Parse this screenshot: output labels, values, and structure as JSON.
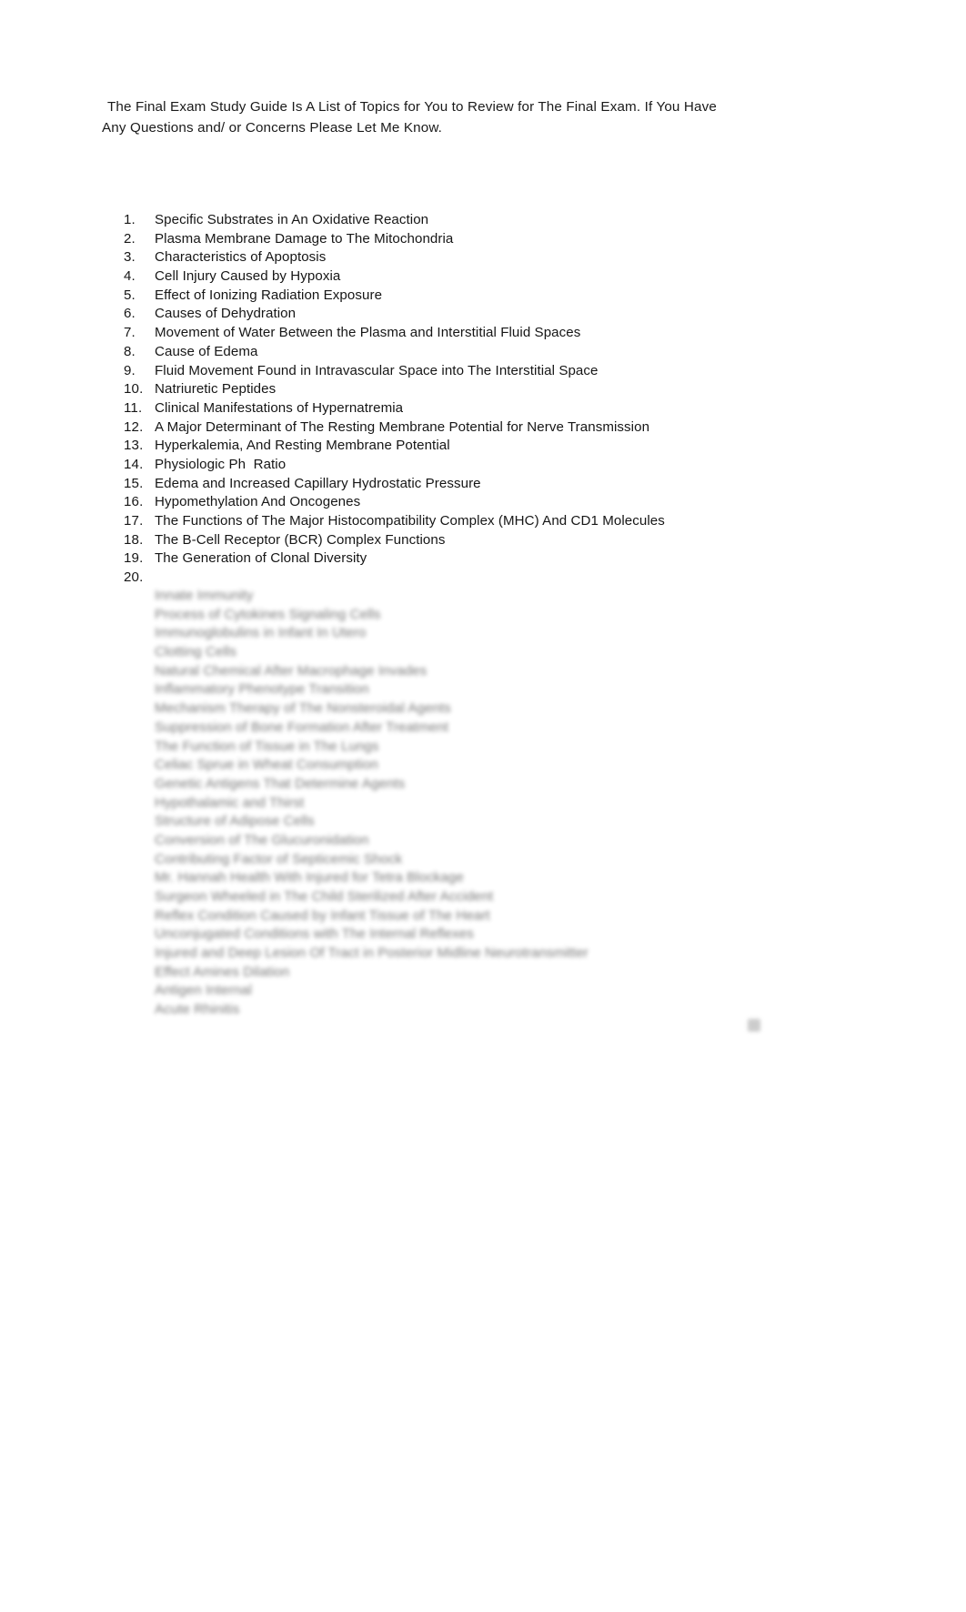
{
  "document": {
    "intro_line_1": "The Final Exam Study Guide Is A List of Topics for You to Review for The Final Exam. If You Have Any",
    "intro_line_2": "Questions and/ or Concerns Please Let Me Know.",
    "intro_paragraph": "The Final Exam Study Guide Is A List of Topics for You to Review for The Final Exam. If You Have Any Questions and/ or Concerns Please Let Me Know.",
    "text_color": "#161616",
    "background_color": "#ffffff"
  },
  "study_guide_list": {
    "items": [
      {
        "number": "1.",
        "text": "Specific Substrates in An Oxidative Reaction"
      },
      {
        "number": "2.",
        "text": "Plasma Membrane Damage to The Mitochondria"
      },
      {
        "number": "3.",
        "text": "Characteristics of Apoptosis"
      },
      {
        "number": "4.",
        "text": "Cell Injury Caused by Hypoxia"
      },
      {
        "number": "5.",
        "text": "Effect of Ionizing Radiation Exposure"
      },
      {
        "number": "6.",
        "text": "Causes of Dehydration"
      },
      {
        "number": "7.",
        "text": "Movement of Water Between the Plasma and Interstitial Fluid Spaces"
      },
      {
        "number": "8.",
        "text": "Cause of Edema"
      },
      {
        "number": "9.",
        "text": "Fluid Movement Found in Intravascular Space into The Interstitial Space"
      },
      {
        "number": "10.",
        "text": "Natriuretic Peptides"
      },
      {
        "number": "11.",
        "text": "Clinical Manifestations of Hypernatremia"
      },
      {
        "number": "12.",
        "text": "A Major Determinant of The Resting Membrane Potential for Nerve Transmission"
      },
      {
        "number": "13.",
        "text": "Hyperkalemia, And Resting Membrane Potential"
      },
      {
        "number": "14.",
        "text": "Physiologic Ph  Ratio"
      },
      {
        "number": "15.",
        "text": "Edema and Increased Capillary Hydrostatic Pressure"
      },
      {
        "number": "16.",
        "text": "Hypomethylation And Oncogenes"
      },
      {
        "number": "17.",
        "text": "The Functions of The Major Histocompatibility Complex (MHC) And CD1 Molecules"
      },
      {
        "number": "18.",
        "text": "The B-Cell Receptor (BCR) Complex Functions"
      },
      {
        "number": "19.",
        "text": "The Generation of Clonal Diversity"
      },
      {
        "number": "20.",
        "text": ""
      }
    ],
    "obscured_items": [
      {
        "number": "",
        "text": "Innate Immunity"
      },
      {
        "number": "",
        "text": "Process of Cytokines Signaling Cells"
      },
      {
        "number": "",
        "text": "Immunoglobulins in Infant In Utero"
      },
      {
        "number": "",
        "text": "Clotting Cells"
      },
      {
        "number": "",
        "text": "Natural Chemical After Macrophage Invades"
      },
      {
        "number": "",
        "text": "Inflammatory Phenotype Transition"
      },
      {
        "number": "",
        "text": "Mechanism Therapy of The Nonsteroidal Agents"
      },
      {
        "number": "",
        "text": "Suppression of Bone Formation After Treatment"
      },
      {
        "number": "",
        "text": "The Function of Tissue in The Lungs"
      },
      {
        "number": "",
        "text": "Celiac Sprue in Wheat Consumption"
      },
      {
        "number": "",
        "text": "Genetic Antigens That Determine Agents"
      },
      {
        "number": "",
        "text": "Hypothalamic and Thirst"
      },
      {
        "number": "",
        "text": "Structure of Adipose Cells"
      },
      {
        "number": "",
        "text": "Conversion of The Glucuronidation"
      },
      {
        "number": "",
        "text": "Contributing Factor of Septicemic Shock"
      },
      {
        "number": "",
        "text": "Mr. Hannah Health With Injured for Tetra Blockage"
      },
      {
        "number": "",
        "text": "Surgeon Wheeled in The Child Sterilized After Accident"
      },
      {
        "number": "",
        "text": "Reflex Condition Caused by Infant Tissue of The Heart"
      },
      {
        "number": "",
        "text": "Unconjugated Conditions with The Internal Reflexes"
      },
      {
        "number": "",
        "text": "Injured and Deep Lesion Of Tract in Posterior Midline Neurotransmitter"
      },
      {
        "number": "",
        "text": "Effect Amines Dilation"
      },
      {
        "number": "",
        "text": "Antigen Internal"
      },
      {
        "number": "",
        "text": "Acute Rhinitis"
      }
    ]
  }
}
